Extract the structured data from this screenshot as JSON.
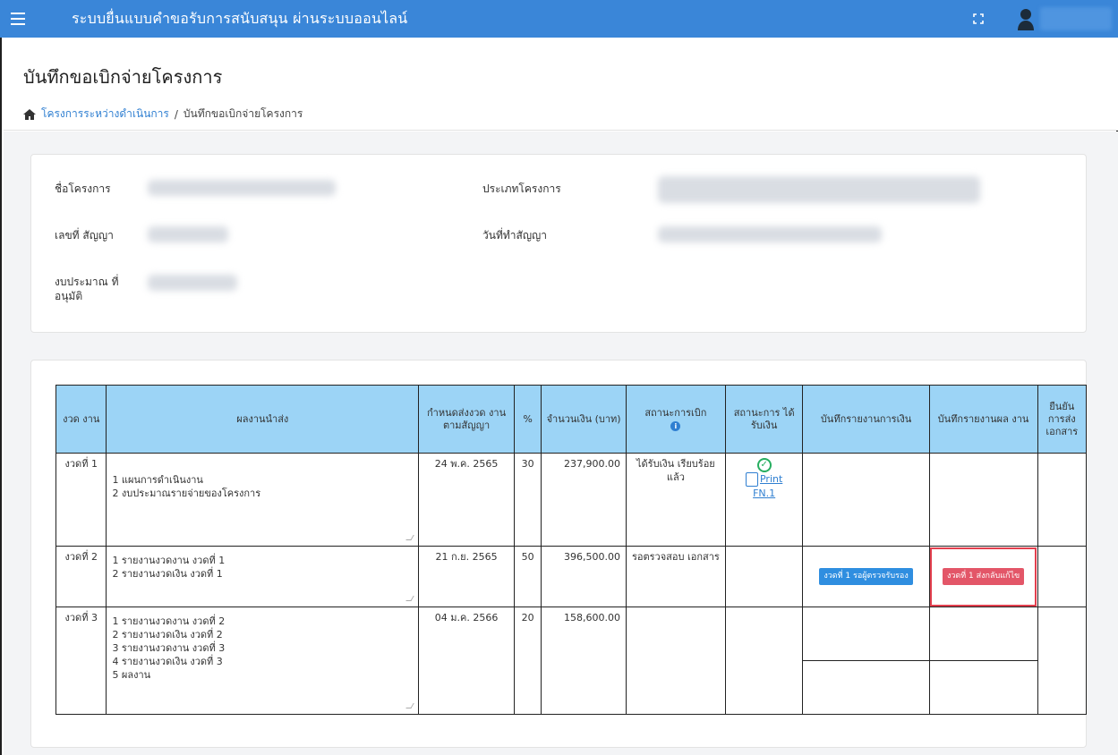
{
  "app": {
    "title": "ระบบยื่นแบบคำขอรับการสนับสนุน ผ่านระบบออนไลน์"
  },
  "page": {
    "title": "บันทึกขอเบิกจ่ายโครงการ",
    "breadcrumb": {
      "link": "โครงการระหว่างดำเนินการ",
      "separator": "/",
      "current": "บันทึกขอเบิกจ่ายโครงการ"
    }
  },
  "project_info": {
    "name_label": "ชื่อโครงการ",
    "type_label": "ประเภทโครงการ",
    "contract_no_label": "เลขที่ สัญญา",
    "contract_date_label": "วันที่ทำสัญญา",
    "budget_label": "งบประมาณ ที่อนุมัติ"
  },
  "table": {
    "headers": {
      "installment": "งวด งาน",
      "deliverables": "ผลงานนำส่ง",
      "due": "กำหนดส่งงวด งานตามสัญญา",
      "percent": "%",
      "amount": "จำนวนเงิน (บาท)",
      "withdraw_status": "สถานะการเบิก",
      "received_status": "สถานะการ ได้รับเงิน",
      "finance_report": "บันทึกรายงานการเงิน",
      "result_report": "บันทึกรายงานผล งาน",
      "confirm_docs": "ยืนยัน การส่ง เอกสาร"
    },
    "rows": [
      {
        "installment": "งวดที่ 1",
        "deliverables": [
          "1 แผนการดำเนินงาน",
          "2 งบประมาณรายจ่ายของโครงการ"
        ],
        "due": "24 พ.ค. 2565",
        "percent": "30",
        "amount": "237,900.00",
        "withdraw_status": "ได้รับเงิน เรียบร้อยแล้ว",
        "print_label": "Print",
        "print_code": "FN.1"
      },
      {
        "installment": "งวดที่ 2",
        "deliverables": [
          "1 รายงานงวดงาน งวดที่ 1",
          "2 รายงานงวดเงิน งวดที่ 1"
        ],
        "due": "21 ก.ย. 2565",
        "percent": "50",
        "amount": "396,500.00",
        "withdraw_status": "รอตรวจสอบ เอกสาร",
        "finance_badge": "งวดที่ 1 รอผู้ตรวจรับรอง",
        "result_badge": "งวดที่ 1 ส่งกลับแก้ไข"
      },
      {
        "installment": "งวดที่ 3",
        "deliverables": [
          "1 รายงานงวดงาน งวดที่ 2",
          "2 รายงานงวดเงิน งวดที่ 2",
          "3 รายงานงวดงาน งวดที่ 3",
          "4 รายงานงวดเงิน งวดที่ 3",
          "5 ผลงาน"
        ],
        "due": "04 ม.ค. 2566",
        "percent": "20",
        "amount": "158,600.00",
        "withdraw_status": ""
      }
    ]
  },
  "colors": {
    "topbar": "#3a86d8",
    "header_row": "#9cd4f6",
    "badge_blue": "#2f8ee0",
    "badge_red": "#e35668",
    "success": "#27ae60"
  }
}
